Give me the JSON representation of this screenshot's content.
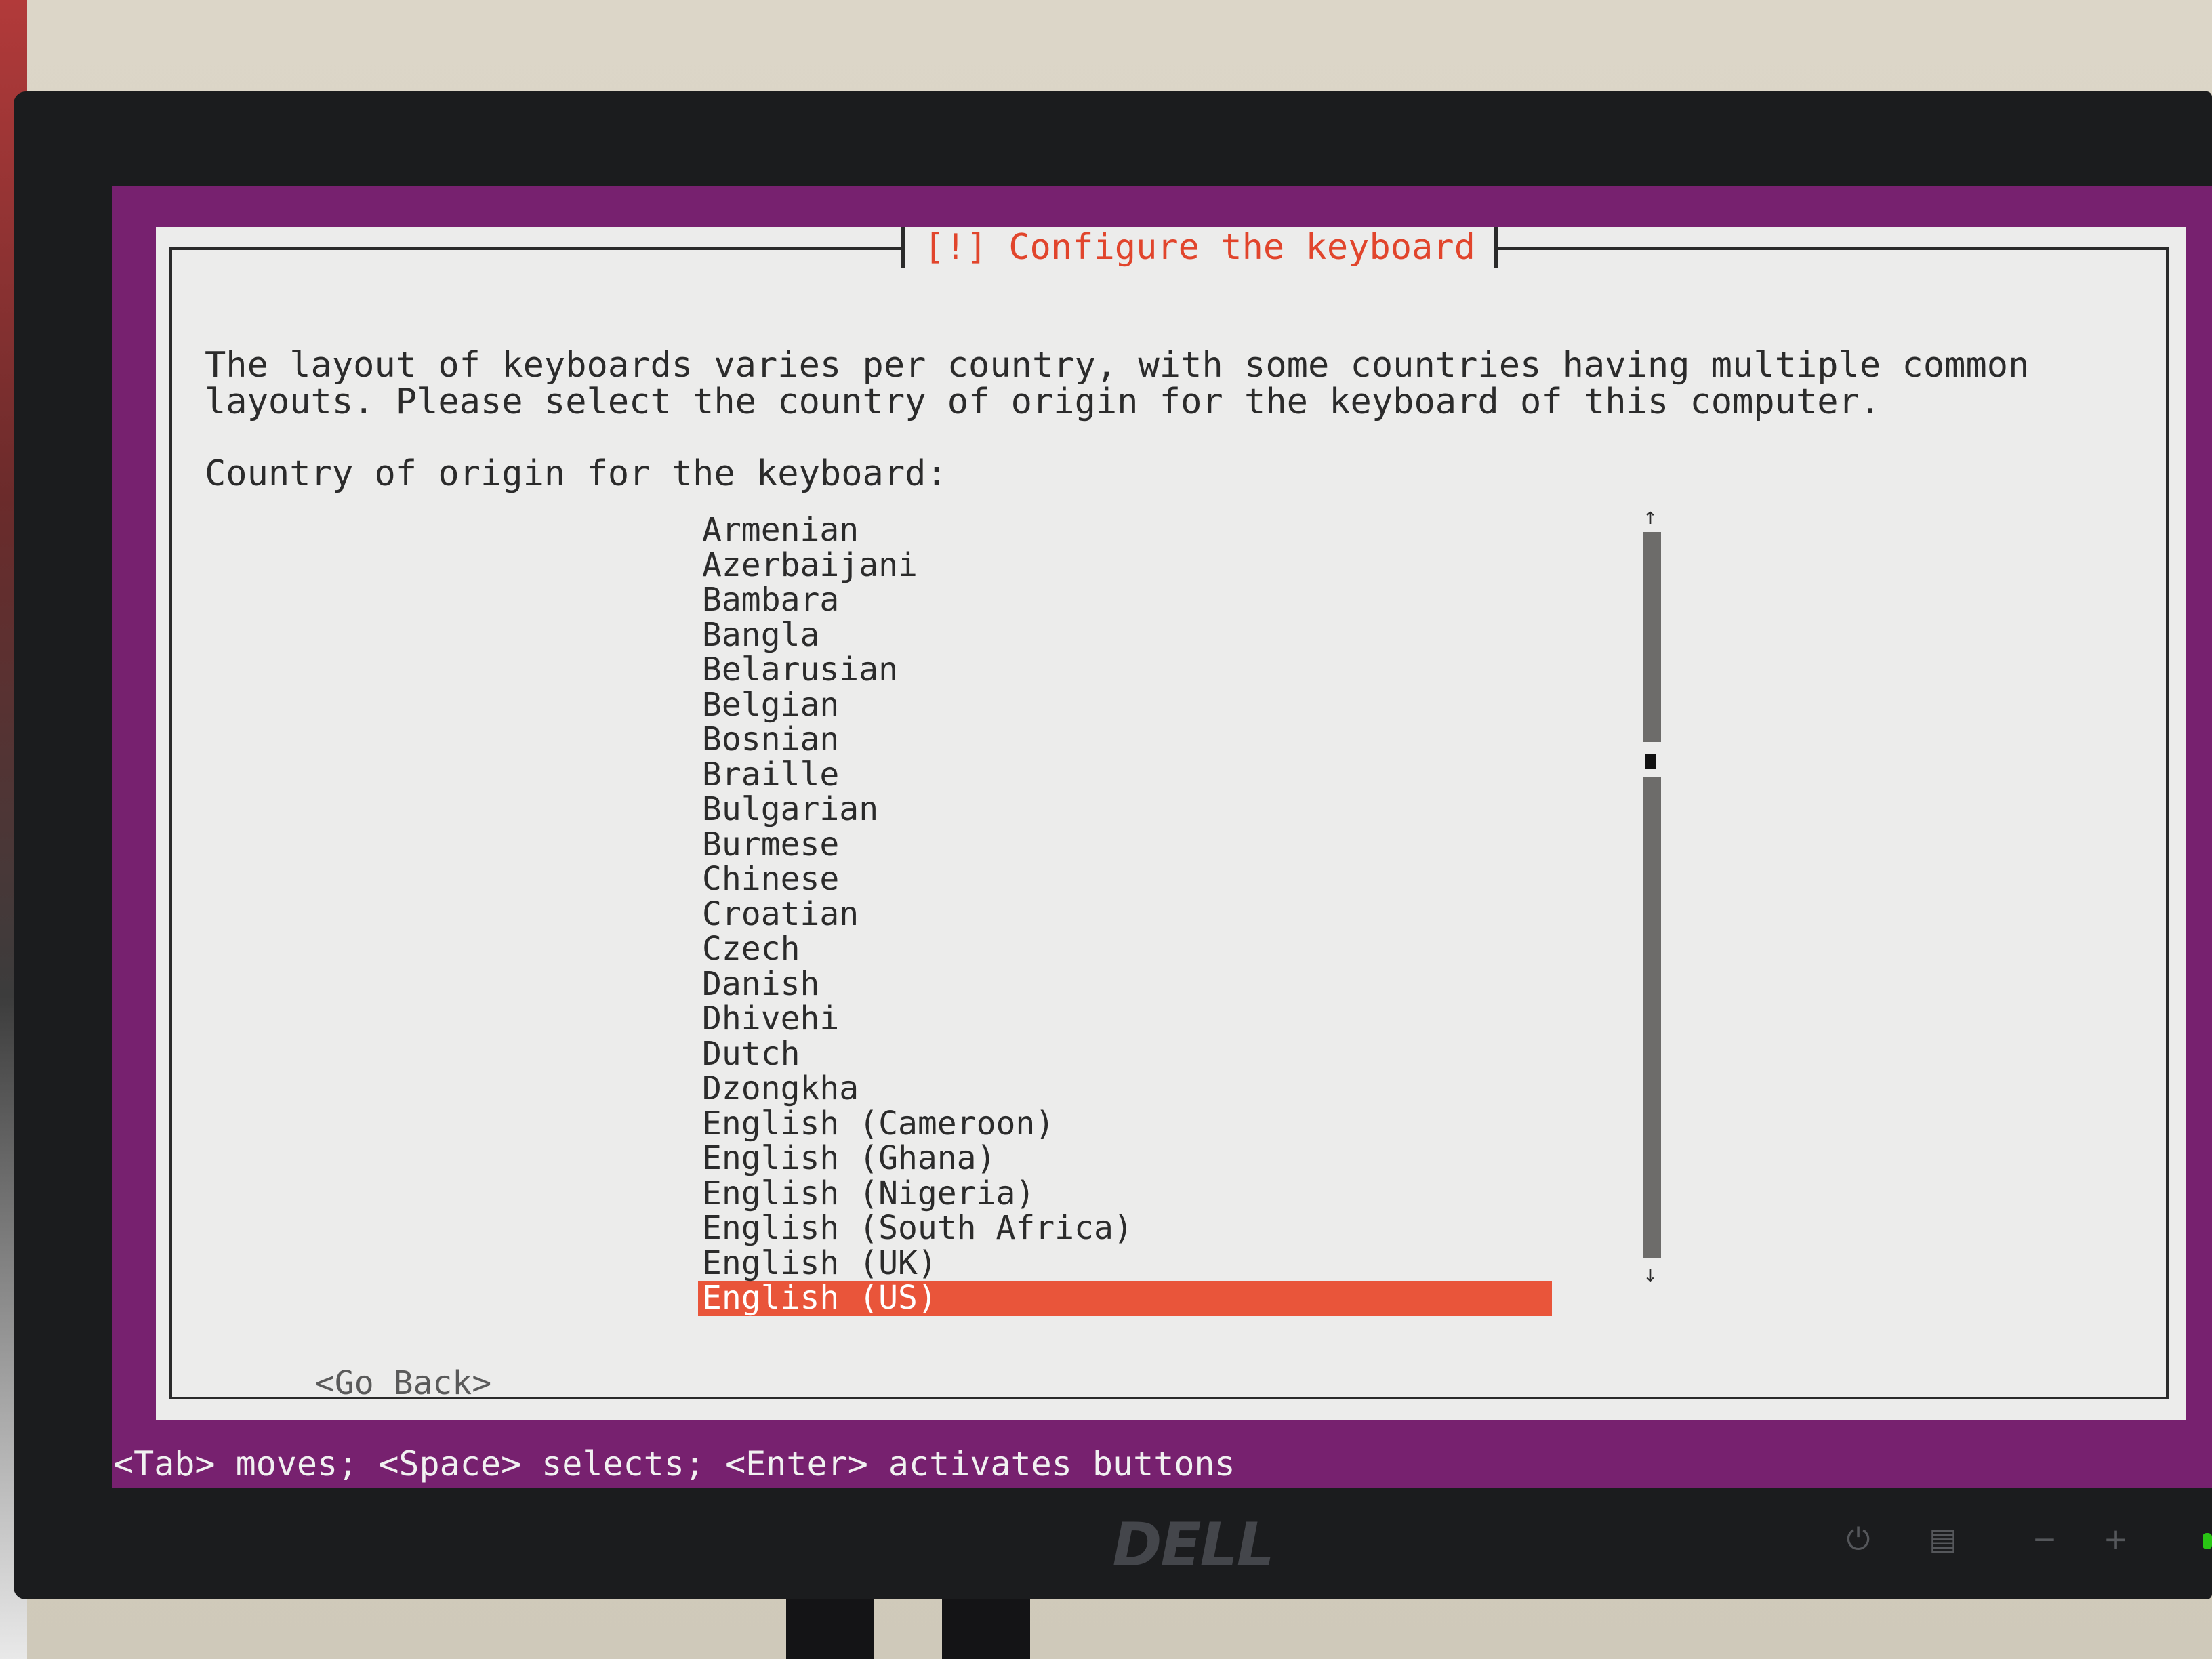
{
  "monitor": {
    "brand": "DELL",
    "buttons": [
      "⏻",
      "▤",
      "−",
      "+"
    ]
  },
  "dialog": {
    "title": "[!] Configure the keyboard",
    "description_line1": "The layout of keyboards varies per country, with some countries having multiple common",
    "description_line2": "layouts. Please select the country of origin for the keyboard of this computer.",
    "prompt": "Country of origin for the keyboard:",
    "items": [
      {
        "label": "Armenian"
      },
      {
        "label": "Azerbaijani"
      },
      {
        "label": "Bambara"
      },
      {
        "label": "Bangla"
      },
      {
        "label": "Belarusian"
      },
      {
        "label": "Belgian"
      },
      {
        "label": "Bosnian"
      },
      {
        "label": "Braille"
      },
      {
        "label": "Bulgarian"
      },
      {
        "label": "Burmese"
      },
      {
        "label": "Chinese"
      },
      {
        "label": "Croatian"
      },
      {
        "label": "Czech"
      },
      {
        "label": "Danish"
      },
      {
        "label": "Dhivehi"
      },
      {
        "label": "Dutch"
      },
      {
        "label": "Dzongkha"
      },
      {
        "label": "English (Cameroon)"
      },
      {
        "label": "English (Ghana)"
      },
      {
        "label": "English (Nigeria)"
      },
      {
        "label": "English (South Africa)"
      },
      {
        "label": "English (UK)"
      },
      {
        "label": "English (US)",
        "selected": true
      }
    ],
    "scroll_up_arrow": "↑",
    "scroll_down_arrow": "↓",
    "go_back": "<Go Back>"
  },
  "status_bar": "<Tab> moves; <Space> selects; <Enter> activates buttons",
  "colors": {
    "background": "#77216f",
    "dialog": "#ececeb",
    "title": "#e1452c",
    "selection": "#e9553a"
  }
}
